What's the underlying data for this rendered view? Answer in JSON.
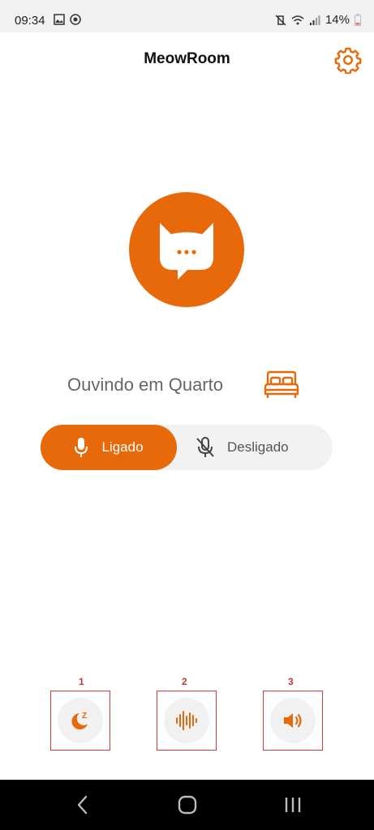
{
  "status_bar": {
    "time": "09:34",
    "battery": "14%"
  },
  "header": {
    "title": "MeowRoom",
    "settings_icon": "gear-icon"
  },
  "main": {
    "logo_icon": "cat-chat-icon",
    "listening_text": "Ouvindo em Quarto",
    "room_icon": "bed-icon",
    "toggle": {
      "on_label": "Ligado",
      "off_label": "Desligado",
      "selected": "Ligado"
    }
  },
  "actions": [
    {
      "number": "1",
      "icon": "sleep-moon-icon"
    },
    {
      "number": "2",
      "icon": "sound-wave-icon"
    },
    {
      "number": "3",
      "icon": "speaker-icon"
    }
  ],
  "colors": {
    "accent": "#E8690A",
    "annotation": "#D23B3B"
  }
}
